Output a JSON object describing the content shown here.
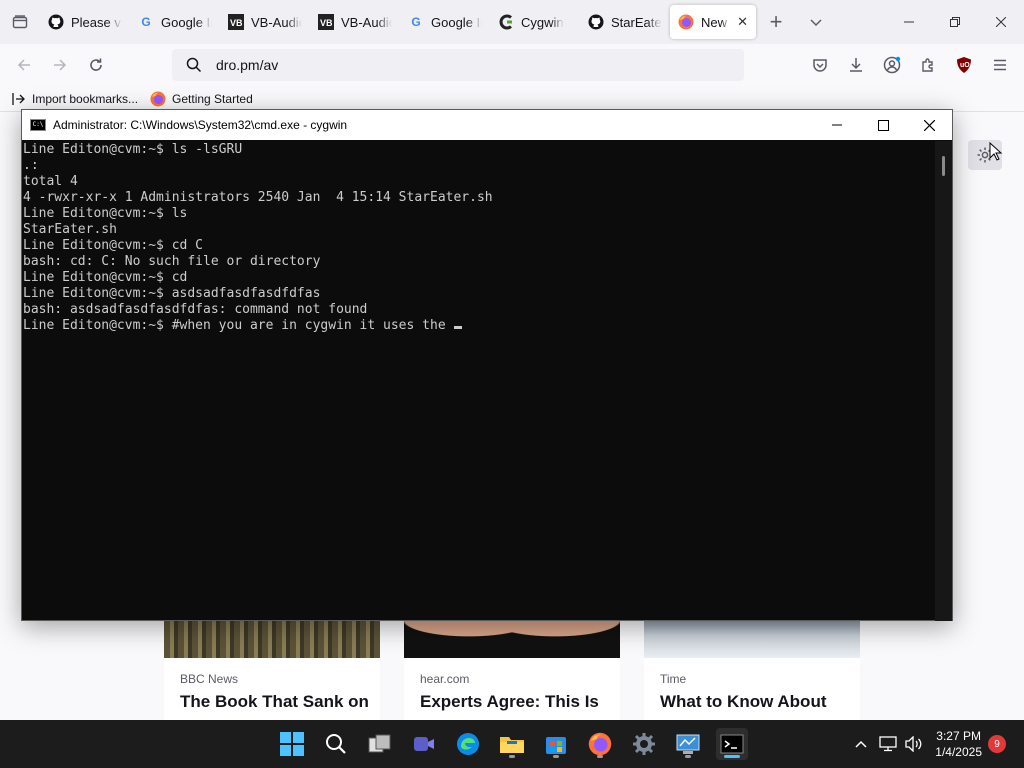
{
  "browser": {
    "tabs": [
      {
        "title": "Please verify",
        "icon": "github-icon"
      },
      {
        "title": "Google Images",
        "icon": "google-icon"
      },
      {
        "title": "VB-Audio",
        "icon": "vb-audio-icon"
      },
      {
        "title": "VB-Audio",
        "icon": "vb-audio-icon"
      },
      {
        "title": "Google Images",
        "icon": "google-icon"
      },
      {
        "title": "Cygwin",
        "icon": "cygwin-icon"
      },
      {
        "title": "StarEater",
        "icon": "github-icon"
      },
      {
        "title": "New Tab",
        "icon": "firefox-icon",
        "active": true
      }
    ],
    "url": "dro.pm/av",
    "bookmarks": [
      {
        "label": "Import bookmarks...",
        "icon": "import-icon"
      },
      {
        "label": "Getting Started",
        "icon": "firefox-icon"
      }
    ],
    "news_cards": [
      {
        "source": "BBC News",
        "headline": "The Book That Sank on"
      },
      {
        "source": "hear.com",
        "headline": "Experts Agree: This Is"
      },
      {
        "source": "Time",
        "headline": "What to Know About"
      }
    ]
  },
  "cmd": {
    "title": "Administrator: C:\\Windows\\System32\\cmd.exe - cygwin",
    "lines": [
      "Line Editon@cvm:~$ ls -lsGRU",
      ".:",
      "total 4",
      "4 -rwxr-xr-x 1 Administrators 2540 Jan  4 15:14 StarEater.sh",
      "Line Editon@cvm:~$ ls",
      "StarEater.sh",
      "Line Editon@cvm:~$ cd C",
      "bash: cd: C: No such file or directory",
      "Line Editon@cvm:~$ cd",
      "Line Editon@cvm:~$ asdsadfasdfasdfdfas",
      "bash: asdsadfasdfasdfdfas: command not found"
    ],
    "current_line": "Line Editon@cvm:~$ #when you are in cygwin it uses the"
  },
  "taskbar": {
    "time": "3:27 PM",
    "date": "1/4/2025",
    "notification_count": "9"
  },
  "colors": {
    "accent": "#0078d4",
    "terminal_bg": "#0c0c0c",
    "terminal_fg": "#cccccc"
  }
}
